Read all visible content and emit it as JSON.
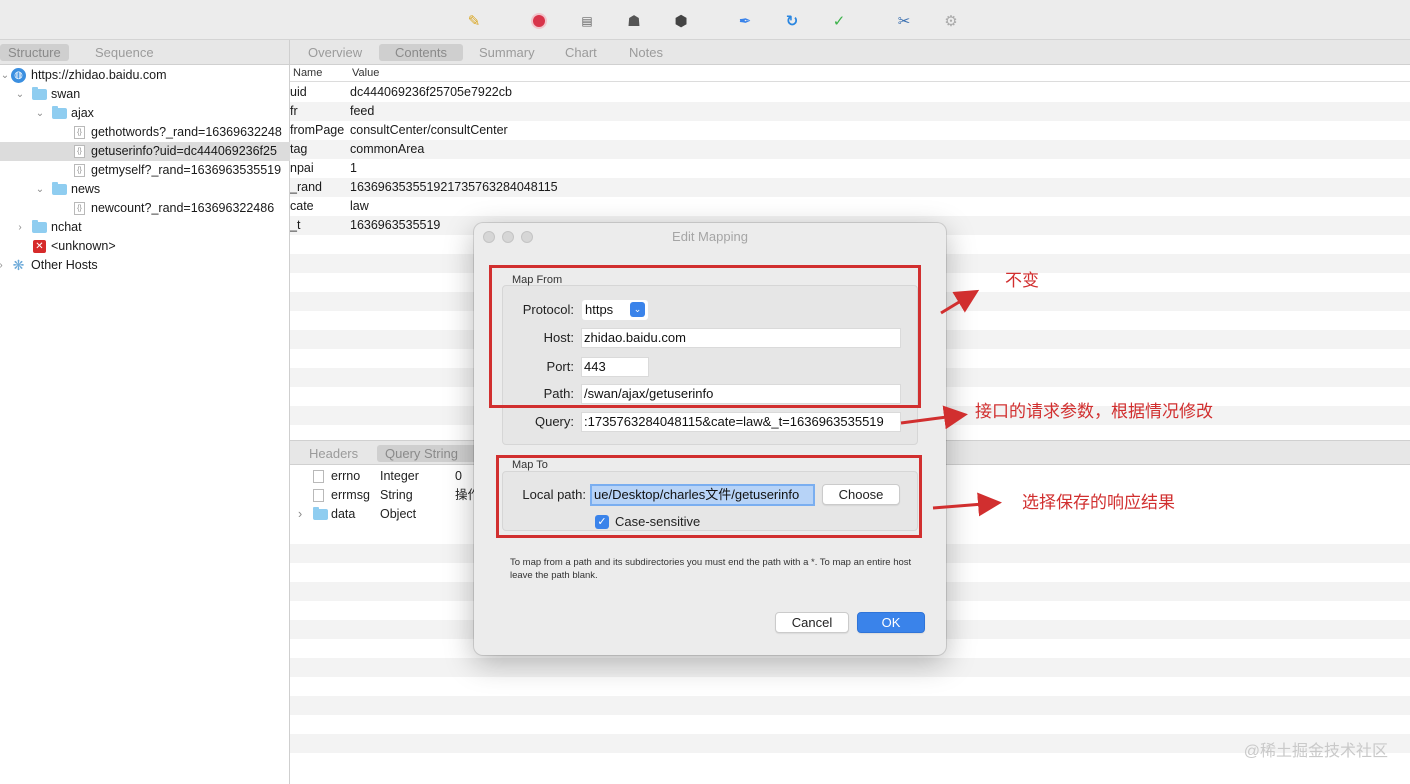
{
  "toolbar": {
    "icons": [
      "broom-icon",
      "record-icon",
      "throttle-icon",
      "turtle-icon",
      "stop-icon",
      "pen-icon",
      "refresh-icon",
      "check-icon",
      "tools-icon",
      "settings-icon"
    ]
  },
  "left_tabs": {
    "structure": "Structure",
    "sequence": "Sequence"
  },
  "tree": {
    "host": "https://zhidao.baidu.com",
    "swan": "swan",
    "ajax": "ajax",
    "item1": "gethotwords?_rand=16369632248",
    "item2": "getuserinfo?uid=dc444069236f25",
    "item3": "getmyself?_rand=1636963535519",
    "news": "news",
    "item4": "newcount?_rand=163696322486",
    "nchat": "nchat",
    "unknown": "<unknown>",
    "other": "Other Hosts",
    "file_glyph": "{}"
  },
  "right_tabs": {
    "overview": "Overview",
    "contents": "Contents",
    "summary": "Summary",
    "chart": "Chart",
    "notes": "Notes"
  },
  "columns": {
    "name": "Name",
    "value": "Value"
  },
  "params": [
    {
      "k": "uid",
      "v": "dc444069236f25705e7922cb"
    },
    {
      "k": "fr",
      "v": "feed"
    },
    {
      "k": "fromPage",
      "v": "consultCenter/consultCenter"
    },
    {
      "k": "tag",
      "v": "commonArea"
    },
    {
      "k": "npai",
      "v": "1"
    },
    {
      "k": "_rand",
      "v": "16369635355192173576328404811​5"
    },
    {
      "k": "cate",
      "v": "law"
    },
    {
      "k": "_t",
      "v": "1636963535519"
    }
  ],
  "bottom_tabs": {
    "headers": "Headers",
    "query": "Query String"
  },
  "response": [
    {
      "name": "errno",
      "type": "Integer",
      "val": "0"
    },
    {
      "name": "errmsg",
      "type": "String",
      "val": "操作"
    },
    {
      "name": "data",
      "type": "Object",
      "val": ""
    }
  ],
  "dialog": {
    "title": "Edit Mapping",
    "map_from": "Map From",
    "protocol_label": "Protocol:",
    "protocol": "https",
    "host_label": "Host:",
    "host": "zhidao.baidu.com",
    "port_label": "Port:",
    "port": "443",
    "path_label": "Path:",
    "path": "/swan/ajax/getuserinfo",
    "query_label": "Query:",
    "query": ":1735763284048115&cate=law&_t=1636963535519",
    "map_to": "Map To",
    "local_label": "Local path:",
    "local": "ue/Desktop/charles文件/getuserinfo",
    "choose": "Choose",
    "case": "Case-sensitive",
    "help": "To map from a path and its subdirectories you must end the path with a *. To map an entire host leave the path blank.",
    "cancel": "Cancel",
    "ok": "OK"
  },
  "annotations": {
    "a1": "不变",
    "a2": "接口的请求参数，根据情况修改",
    "a3": "选择保存的响应结果"
  },
  "watermark": "@稀土掘金技术社区",
  "colors": {
    "accent": "#3a83ea",
    "annotation": "#d12f2f"
  }
}
